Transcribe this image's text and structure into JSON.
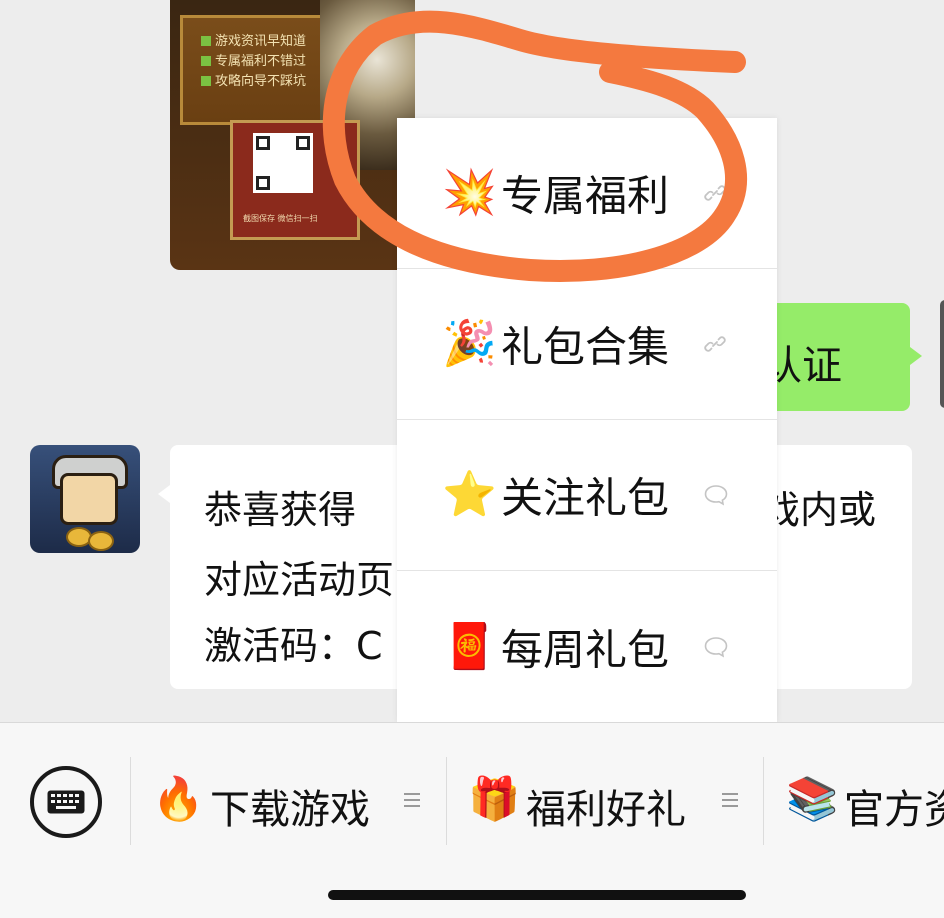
{
  "promo": {
    "checks": [
      "游戏资讯早知道",
      "专属福利不错过",
      "攻略向导不踩坑"
    ],
    "qr_caption": "截图保存 微信扫一扫"
  },
  "sent_message": {
    "visible_text": "认证"
  },
  "received_message": {
    "line1_left": "恭喜获得",
    "line1_right": "戏内或",
    "line2_left": "对应活动页",
    "line3_left": "激活码：C"
  },
  "popup_menu": {
    "items": [
      {
        "label": "专属福利",
        "icon": "collision-emoji",
        "emoji": "💥",
        "trail": "link-icon"
      },
      {
        "label": "礼包合集",
        "icon": "party-popper-emoji",
        "emoji": "🎉",
        "trail": "link-icon"
      },
      {
        "label": "关注礼包",
        "icon": "star-emoji",
        "emoji": "⭐",
        "trail": "chat-bubble-icon"
      },
      {
        "label": "每周礼包",
        "icon": "red-envelope-emoji",
        "emoji": "🧧",
        "trail": "chat-bubble-icon"
      }
    ]
  },
  "bottom_menu": {
    "keyboard_icon": "keyboard-icon",
    "items": [
      {
        "label": "下载游戏",
        "icon": "fire-emoji",
        "emoji": "🔥"
      },
      {
        "label": "福利好礼",
        "icon": "gift-emoji",
        "emoji": "🎁"
      },
      {
        "label": "官方资",
        "icon": "books-emoji",
        "emoji": "📚"
      }
    ]
  },
  "colors": {
    "background": "#ededed",
    "sent_bubble": "#95ec69",
    "annotation": "#f4793f"
  }
}
